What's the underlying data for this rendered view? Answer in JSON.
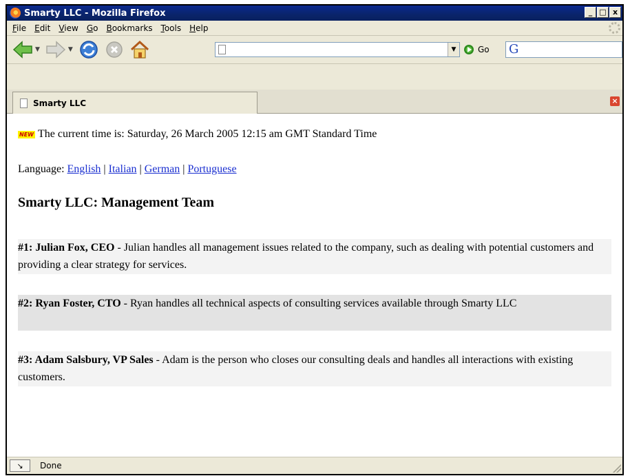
{
  "window": {
    "title": "Smarty LLC - Mozilla Firefox"
  },
  "menu": [
    {
      "first": "F",
      "rest": "ile"
    },
    {
      "first": "E",
      "rest": "dit"
    },
    {
      "first": "V",
      "rest": "iew"
    },
    {
      "first": "G",
      "rest": "o"
    },
    {
      "first": "B",
      "rest": "ookmarks"
    },
    {
      "first": "T",
      "rest": "ools"
    },
    {
      "first": "H",
      "rest": "elp"
    }
  ],
  "toolbar": {
    "go_label": "Go",
    "url_value": ""
  },
  "tab": {
    "title": "Smarty LLC"
  },
  "page": {
    "new_badge": "NEW",
    "time_text": "The current time is: Saturday, 26 March 2005 12:15 am GMT Standard Time",
    "language_label": "Language: ",
    "languages": [
      "English",
      "Italian",
      "German",
      "Portuguese"
    ],
    "separator": " | ",
    "heading": "Smarty LLC: Management Team",
    "members": [
      {
        "title": "#1: Julian Fox, CEO",
        "desc": " - Julian handles all management issues related to the company, such as dealing with potential customers and providing a clear strategy for services."
      },
      {
        "title": "#2: Ryan Foster, CTO",
        "desc": " - Ryan handles all technical aspects of consulting services available through Smarty LLC"
      },
      {
        "title": "#3: Adam Salsbury, VP Sales",
        "desc": " - Adam is the person who closes our consulting deals and handles all interactions with existing customers."
      }
    ]
  },
  "status": {
    "text": "Done"
  }
}
